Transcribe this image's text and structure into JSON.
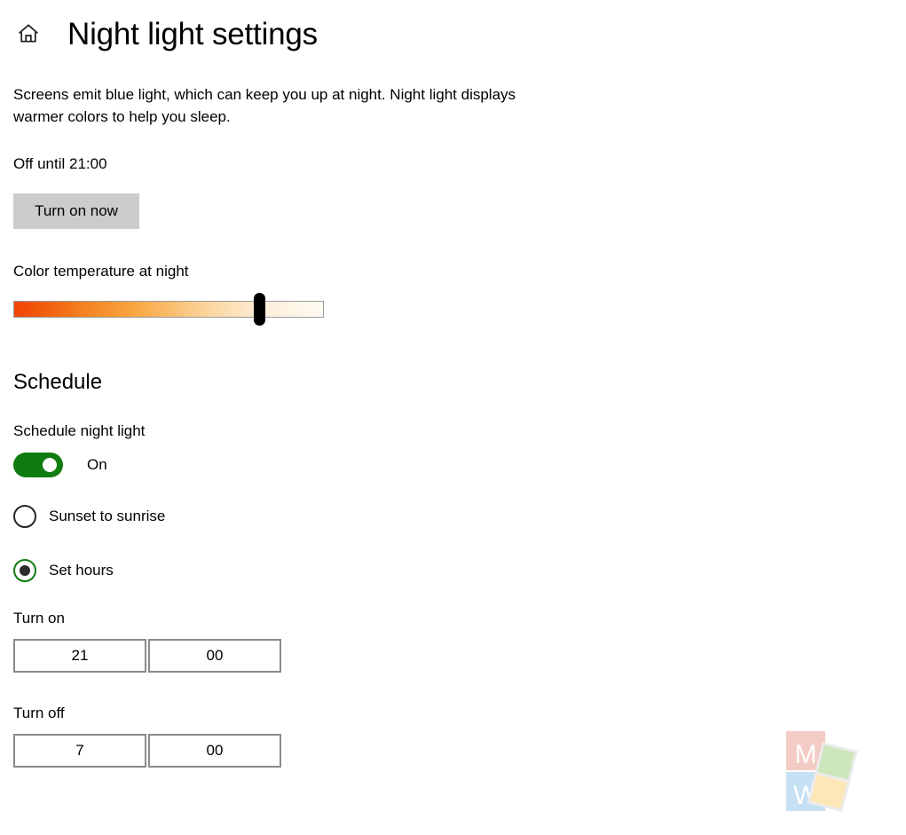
{
  "header": {
    "home_icon": "home-icon",
    "title": "Night light settings"
  },
  "main": {
    "description": "Screens emit blue light, which can keep you up at night. Night light displays warmer colors to help you sleep.",
    "status": "Off until 21:00",
    "turn_on_button": "Turn on now",
    "slider": {
      "label": "Color temperature at night",
      "value_percent": 75,
      "gradient_start": "#f04405",
      "gradient_end": "#fefaf2",
      "thumb_color": "#000000"
    }
  },
  "schedule": {
    "title": "Schedule",
    "toggle_label": "Schedule night light",
    "toggle_state": "On",
    "toggle_on": true,
    "toggle_color": "#107c10",
    "options": [
      {
        "label": "Sunset to sunrise",
        "selected": false
      },
      {
        "label": "Set hours",
        "selected": true
      }
    ],
    "turn_on": {
      "label": "Turn on",
      "hours": "21",
      "minutes": "00"
    },
    "turn_off": {
      "label": "Turn off",
      "hours": "7",
      "minutes": "00"
    }
  },
  "watermark": {
    "letter_top": "M",
    "letter_bottom": "W",
    "color_top": "#f2c4bc",
    "color_bottom": "#bcdcf2",
    "color_green": "#c6e2b0",
    "color_yellow": "#fde3ad"
  }
}
